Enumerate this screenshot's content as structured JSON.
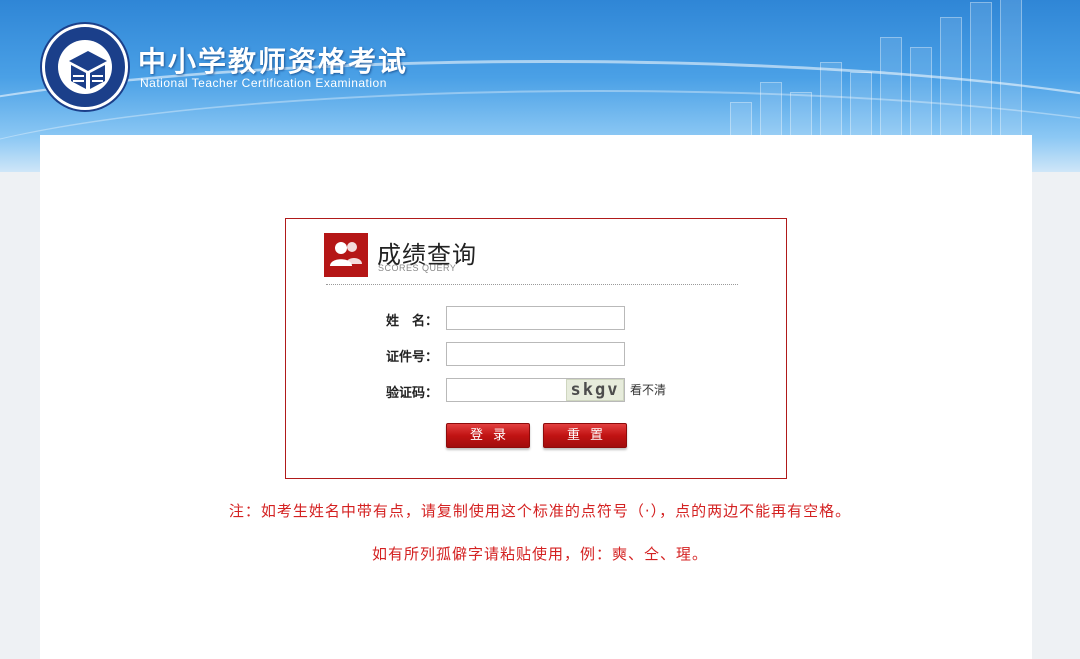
{
  "header": {
    "title_cn": "中小学教师资格考试",
    "title_en": "National Teacher Certification Examination"
  },
  "login": {
    "title": "成绩查询",
    "subtitle": "SCORES QUERY",
    "name_label": "姓　名：",
    "name_value": "",
    "id_label": "证件号：",
    "id_value": "",
    "captcha_label": "验证码：",
    "captcha_value": "",
    "captcha_text": "skgv",
    "captcha_refresh": "看不清",
    "login_button": "登录",
    "reset_button": "重置"
  },
  "notes": {
    "line1": "注：如考生姓名中带有点，请复制使用这个标准的点符号（·），点的两边不能再有空格。",
    "line2": "如有所列孤僻字请粘贴使用，例：奭、仝、瑆。"
  },
  "colors": {
    "accent_red": "#b51616",
    "note_red": "#d42222",
    "banner_blue": "#2f86d6"
  },
  "icons": {
    "logo": "teacher-certification-emblem",
    "box_icon": "users-icon"
  }
}
